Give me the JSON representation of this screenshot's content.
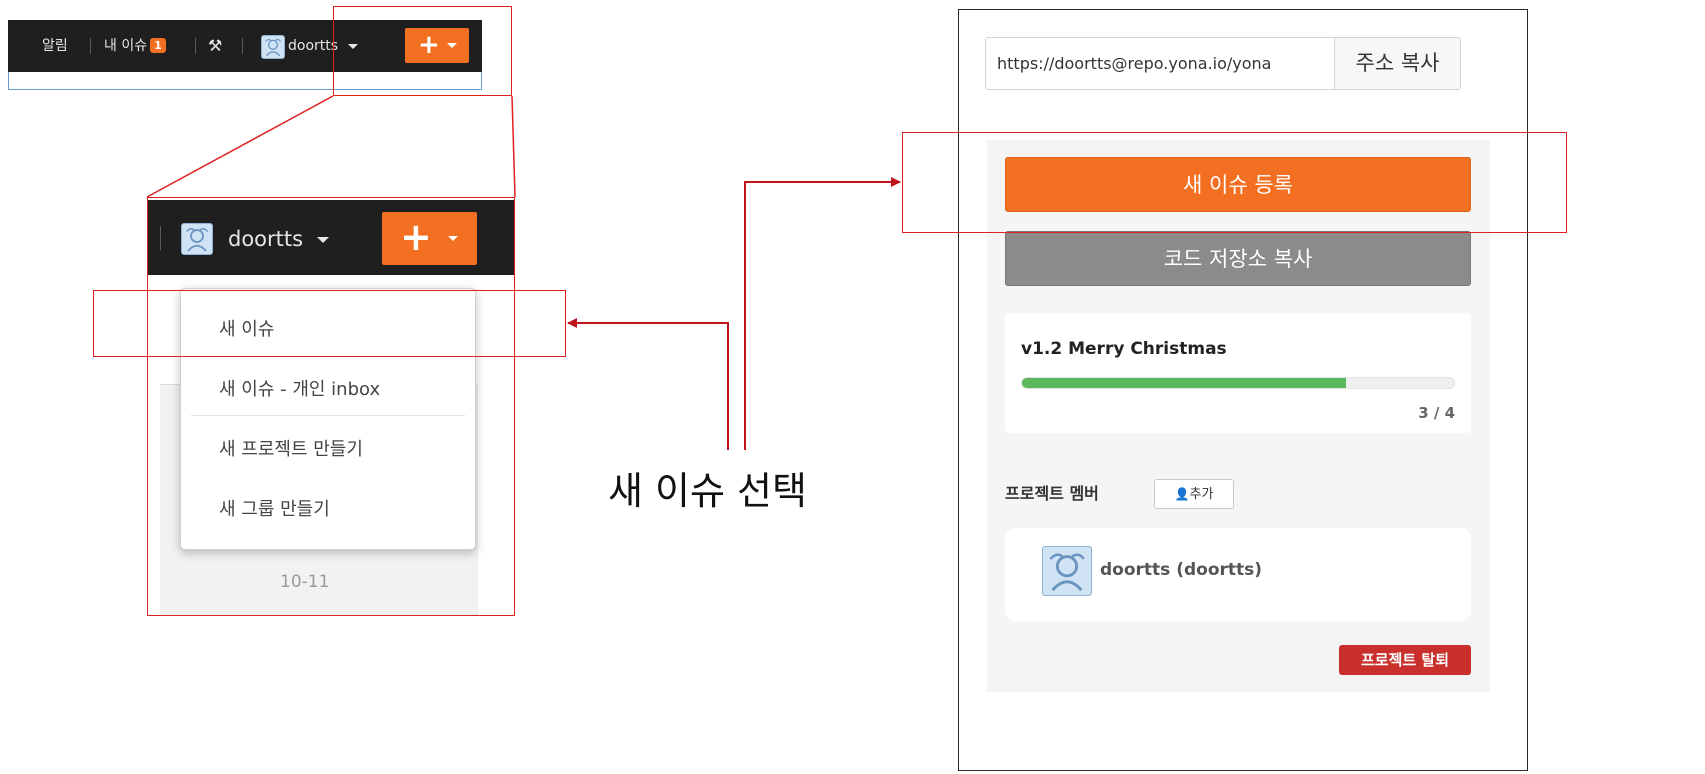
{
  "navbar": {
    "notifications_label": "알림",
    "my_issues_label": "내 이슈",
    "my_issues_count": "1",
    "tools_icon": "wrench-hammer-icon",
    "username": "doortts",
    "plus_symbol": "+"
  },
  "create_menu": {
    "items": [
      {
        "label": "새 이슈"
      },
      {
        "label": "새 이슈 - 개인 inbox"
      },
      {
        "label": "새 프로젝트 만들기"
      },
      {
        "label": "새 그룹 만들기"
      }
    ],
    "background_date": "10-11"
  },
  "callout": {
    "text": "새 이슈 선택"
  },
  "sidebar": {
    "clone_url": "https://doortts@repo.yona.io/yona",
    "copy_url_label": "주소 복사",
    "new_issue_label": "새 이슈 등록",
    "fork_label": "코드 저장소 복사",
    "milestone": {
      "title": "v1.2 Merry Christmas",
      "progress_fraction": 0.75,
      "count_label": "3 / 4"
    },
    "members_label": "프로젝트 멤버",
    "add_member_label": "추가",
    "member_name": "doortts (doortts)",
    "leave_label": "프로젝트 탈퇴"
  },
  "colors": {
    "accent_orange": "#f36f21",
    "navbar_dark": "#1f1f1f",
    "highlight_red": "#e02020",
    "progress_green": "#5cb85c",
    "danger_red": "#c9302c"
  }
}
